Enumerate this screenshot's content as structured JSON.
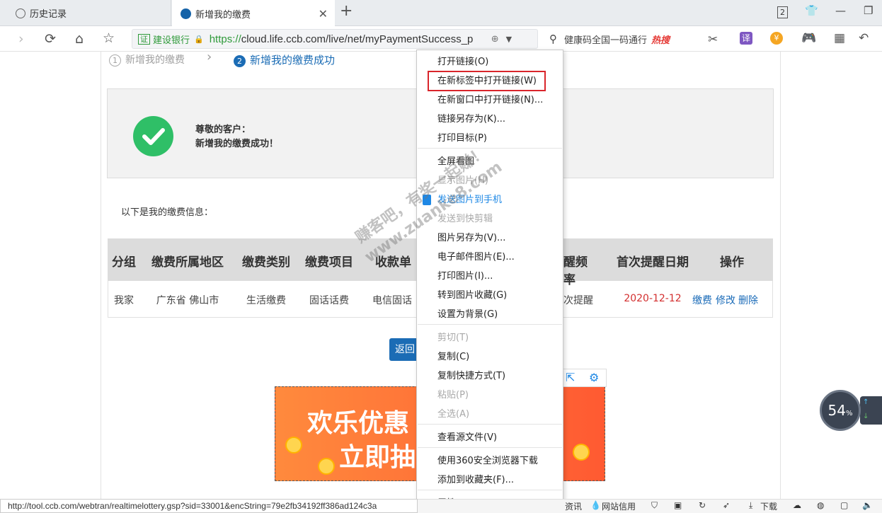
{
  "tabs": [
    {
      "label": "历史记录"
    },
    {
      "label": "新增我的缴费"
    }
  ],
  "tab_count": "2",
  "address": {
    "badge": "证",
    "bank": "建设银行",
    "url_scheme": "https://",
    "url_rest": "cloud.life.ccb.com/live/net/myPaymentSuccess_p"
  },
  "search": {
    "text": "健康码全国一码通行",
    "hot": "热搜"
  },
  "steps": [
    {
      "num": "1",
      "label": "新增我的缴费"
    },
    {
      "num": "2",
      "label": "新增我的缴费成功"
    }
  ],
  "success": {
    "line1": "尊敬的客户：",
    "line2": "新增我的缴费成功！"
  },
  "info_label": "以下是我的缴费信息：",
  "table": {
    "headers": [
      "分组",
      "缴费所属地区",
      "缴费类别",
      "缴费项目",
      "收款单",
      "醒频率",
      "首次提醒日期",
      "操作"
    ],
    "row": {
      "group": "我家",
      "region": "广东省 佛山市",
      "category": "生活缴费",
      "item": "固话话费",
      "payee": "电信固话",
      "freq": "次提醒",
      "date": "2020-12-12",
      "ops": [
        "缴费",
        "修改",
        "删除"
      ]
    }
  },
  "back_button": "返回",
  "banner": {
    "line1": "欢乐优惠",
    "line2": "立即抽"
  },
  "context_menu": [
    {
      "label": "打开链接(O)",
      "state": "normal"
    },
    {
      "label": "在新标签中打开链接(W)",
      "state": "highlight"
    },
    {
      "label": "在新窗口中打开链接(N)...",
      "state": "normal"
    },
    {
      "label": "链接另存为(K)...",
      "state": "normal"
    },
    {
      "label": "打印目标(P)",
      "state": "normal"
    },
    {
      "label": "全屏看图",
      "state": "normal"
    },
    {
      "label": "显示图片(H)",
      "state": "disabled"
    },
    {
      "label": "发送图片到手机",
      "state": "blue"
    },
    {
      "label": "发送到快剪辑",
      "state": "disabled"
    },
    {
      "label": "图片另存为(V)...",
      "state": "normal"
    },
    {
      "label": "电子邮件图片(E)...",
      "state": "normal"
    },
    {
      "label": "打印图片(I)...",
      "state": "normal"
    },
    {
      "label": "转到图片收藏(G)",
      "state": "normal"
    },
    {
      "label": "设置为背景(G)",
      "state": "normal"
    },
    {
      "label": "剪切(T)",
      "state": "disabled"
    },
    {
      "label": "复制(C)",
      "state": "normal"
    },
    {
      "label": "复制快捷方式(T)",
      "state": "normal"
    },
    {
      "label": "粘贴(P)",
      "state": "disabled"
    },
    {
      "label": "全选(A)",
      "state": "disabled"
    },
    {
      "label": "查看源文件(V)",
      "state": "normal"
    },
    {
      "label": "使用360安全浏览器下载",
      "state": "normal"
    },
    {
      "label": "添加到收藏夹(F)...",
      "state": "normal"
    },
    {
      "label": "属性(R)",
      "state": "normal"
    }
  ],
  "status": {
    "url": "http://tool.ccb.com/webtran/realtimelottery.gsp?sid=33001&encString=79e2fb34192ff386ad124c3a",
    "items": [
      "资讯",
      "网站信用",
      "下载"
    ]
  },
  "speed_widget": {
    "value": "54",
    "unit": "%"
  },
  "watermark": {
    "line1": "赚客吧，有奖一起赚！",
    "line2": "www.zuanke8.com"
  }
}
